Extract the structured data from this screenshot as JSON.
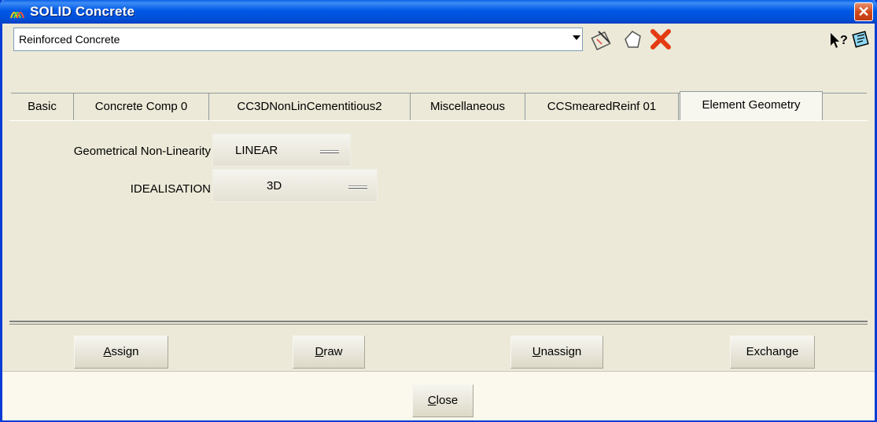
{
  "window": {
    "title": "SOLID Concrete",
    "close_glyph": "✕"
  },
  "toolbar": {
    "material_value": "Reinforced Concrete",
    "icons": [
      "edit-material-icon",
      "shape-icon",
      "delete-icon",
      "context-help-icon",
      "notes-icon"
    ]
  },
  "tabs": [
    "Basic",
    "Concrete Comp 0",
    "CC3DNonLinCementitious2",
    "Miscellaneous",
    "CCSmearedReinf 01",
    "Element Geometry"
  ],
  "element_geometry": {
    "nonlin_label": "Geometrical Non-Linearity",
    "nonlin_value": "LINEAR",
    "ideal_label": "IDEALISATION",
    "ideal_value": "3D"
  },
  "actions": {
    "assign_first": "A",
    "assign_rest": "ssign",
    "draw_first": "D",
    "draw_rest": "raw",
    "unassign_first": "U",
    "unassign_rest": "nassign",
    "exchange": "Exchange"
  },
  "footer": {
    "close_first": "C",
    "close_rest": "lose"
  }
}
